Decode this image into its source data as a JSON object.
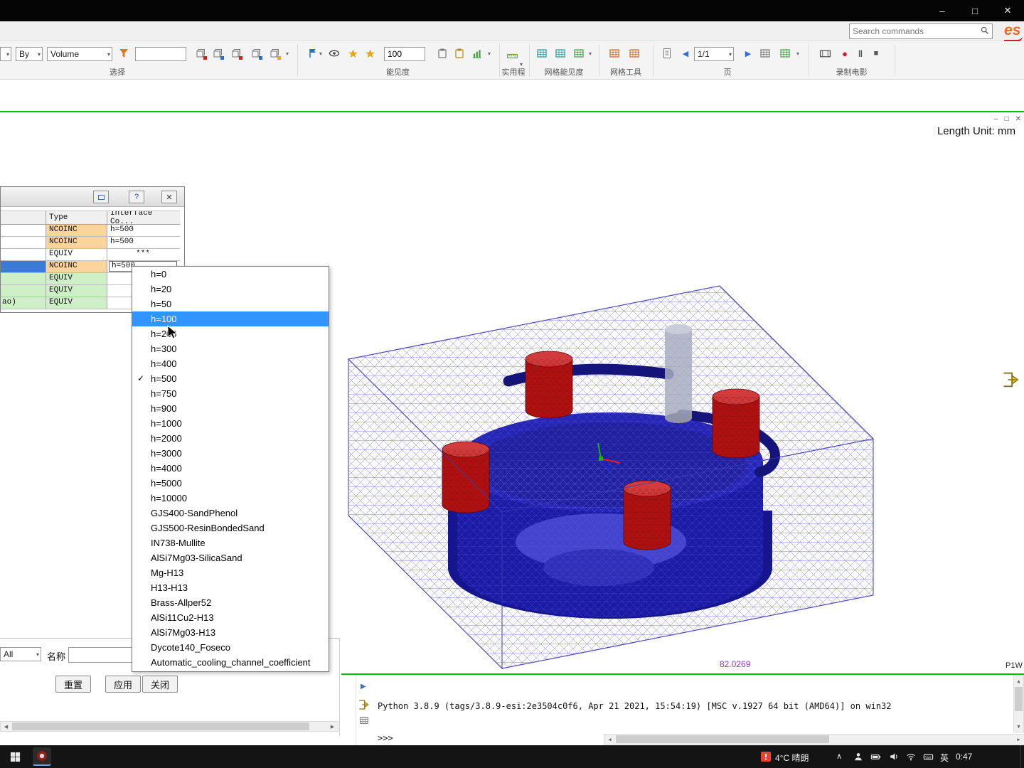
{
  "icons": {
    "minimize": "–",
    "maximize": "□",
    "close": "✕",
    "chevron_down": "▾",
    "arrow_left": "◀",
    "arrow_right": "▶",
    "arrow_up": "▲",
    "arrow_down": "▼",
    "record": "●",
    "pause": "‖",
    "stop": "■",
    "check": "✓",
    "mdi_minimize": "–",
    "mdi_restore": "□",
    "mdi_close": "✕",
    "tray_chevron": "∧"
  },
  "topbar": {
    "search_placeholder": "Search commands",
    "logo_text": "es"
  },
  "ribbon": {
    "select_group": {
      "label": "选择",
      "by": "By",
      "volume": "Volume"
    },
    "visibility_group": {
      "label": "能见度",
      "value": "100"
    },
    "utility_group": {
      "label": "实用程"
    },
    "mesh_visibility_group": {
      "label": "网格能见度"
    },
    "mesh_tools_group": {
      "label": "网格工具"
    },
    "page_group": {
      "label": "页",
      "page": "1/1"
    },
    "movie_group": {
      "label": "录制电影"
    }
  },
  "viewport": {
    "length_unit": "Length Unit: mm",
    "annotation_value": "82.0269",
    "corner_label": "P1W"
  },
  "interface_dialog": {
    "help_button": "?",
    "table": {
      "col_type": "Type",
      "col_interface": "Interface Co...",
      "rows": [
        {
          "type": "NCOINC",
          "value": "h=500"
        },
        {
          "type": "NCOINC",
          "value": "h=500"
        },
        {
          "type": "EQUIV",
          "value": "***"
        },
        {
          "type": "NCOINC",
          "value": "h=500"
        },
        {
          "type": "EQUIV",
          "value": ""
        },
        {
          "type": "EQUIV",
          "value": ""
        },
        {
          "type": "EQUIV",
          "value": "",
          "edge": "ao)"
        }
      ]
    },
    "filter_all": "All",
    "name_label": "名称",
    "reset_button": "重置",
    "apply_button": "应用",
    "close_button": "关闭"
  },
  "coefficient_dropdown": {
    "highlighted_item": "h=100",
    "checked_item": "h=500",
    "items": [
      "h=0",
      "h=20",
      "h=50",
      "h=100",
      "h=200",
      "h=300",
      "h=400",
      "h=500",
      "h=750",
      "h=900",
      "h=1000",
      "h=2000",
      "h=3000",
      "h=4000",
      "h=5000",
      "h=10000",
      "GJS400-SandPhenol",
      "GJS500-ResinBondedSand",
      "IN738-Mullite",
      "AlSi7Mg03-SilicaSand",
      "Mg-H13",
      "H13-H13",
      "Brass-Allper52",
      "AlSi11Cu2-H13",
      "AlSi7Mg03-H13",
      "Dycote140_Foseco",
      "Automatic_cooling_channel_coefficient"
    ]
  },
  "python_console": {
    "banner": "Python 3.8.9 (tags/3.8.9-esi:2e3504c0f6, Apr 21 2021, 15:54:19) [MSC v.1927 64 bit (AMD64)] on win32",
    "prompt": ">>>"
  },
  "taskbar": {
    "weather": "4°C 晴朗",
    "input_lang": "英",
    "time": "0:47"
  }
}
